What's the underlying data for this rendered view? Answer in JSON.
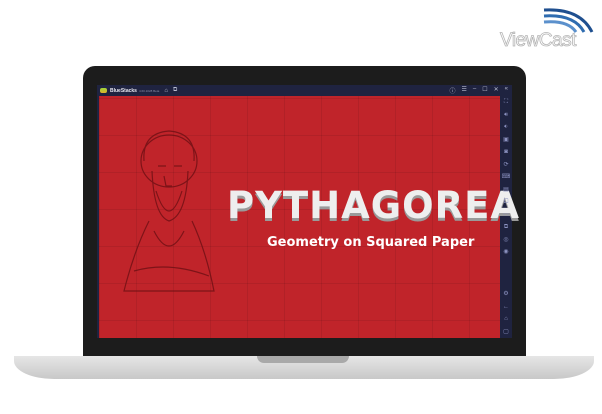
{
  "watermark": {
    "text": "ViewCast"
  },
  "window": {
    "app_name": "BlueStacks",
    "version": "4.60.1028 Beta",
    "controls": [
      "help-icon",
      "menu-icon",
      "minimize-icon",
      "maximize-icon",
      "close-icon",
      "collapse-icon"
    ]
  },
  "game": {
    "title_left": "PYTH",
    "title_right": "GOREA",
    "title_full": "PYTHAGOREA",
    "subtitle": "Geometry on Squared Paper",
    "background": "#c0242a"
  },
  "sidebar": {
    "icons": [
      "fullscreen-icon",
      "volume-up-icon",
      "volume-down-icon",
      "screen-record-icon",
      "screenshot-icon",
      "rotate-icon",
      "keyboard-icon",
      "media-icon",
      "multi-instance-icon",
      "folder-icon",
      "copy-icon",
      "location-icon",
      "shake-icon",
      "settings-icon",
      "back-icon",
      "home-icon",
      "recent-apps-icon"
    ]
  }
}
